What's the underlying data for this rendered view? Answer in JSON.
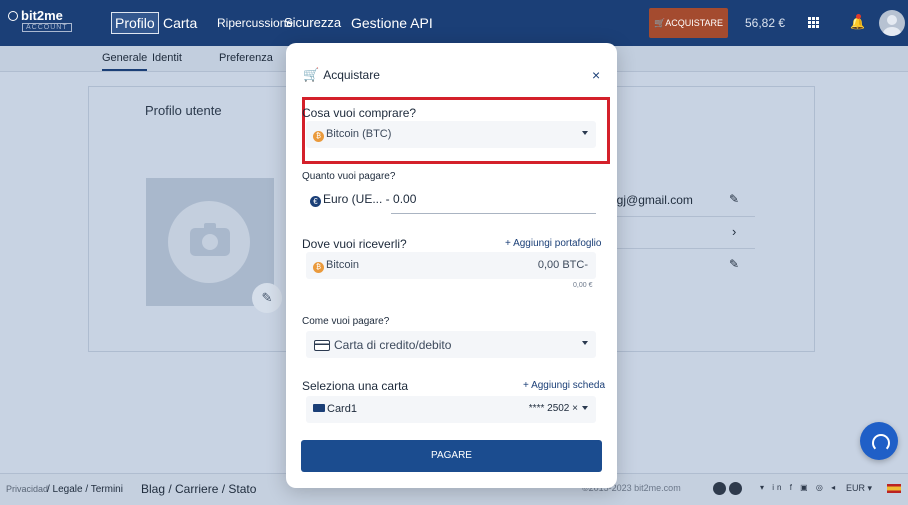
{
  "app": {
    "logo": "bit2me",
    "logo_sub": "ACCOUNT"
  },
  "nav": {
    "items": [
      "Profilo",
      "Carta",
      "Ripercussione",
      "Sicurezza",
      "Gestione API"
    ],
    "buy_label": "ACQUISTARE",
    "balance": "56,82 €"
  },
  "subnav": {
    "items": [
      "Generale",
      "Identit",
      "Preferenza"
    ]
  },
  "profile": {
    "title": "Profilo utente",
    "email_tail": "ngj@gmail.com"
  },
  "footer": {
    "privacy": "Privacidad",
    "legal": "/ Legale / Termini",
    "blog": "Blag / Carriere / Stato",
    "copyright": "©2015-2023 bit2me.com",
    "social": "▾ in f ▣ ◎ ◂",
    "currency": "EUR ▾"
  },
  "modal": {
    "title": "Acquistare",
    "close": "×",
    "buy_question": "Cosa vuoi comprare?",
    "buy_coin": "Bitcoin (BTC)",
    "pay_question": "Quanto vuoi pagare?",
    "pay_currency": "Euro (UE... -",
    "pay_amount": "0.00",
    "receive_question": "Dove vuoi riceverli?",
    "add_wallet": "+ Aggiungi portafoglio",
    "receive_coin": "Bitcoin",
    "receive_amount": "0,00 BTC-",
    "receive_eur": "0,00 €",
    "method_question": "Come vuoi pagare?",
    "method_value": "Carta di credito/debito",
    "card_question": "Seleziona una carta",
    "add_card": "+ Aggiungi scheda",
    "card_name": "Card1",
    "card_number": "**** 2502 ×",
    "pay_button": "PAGARE"
  },
  "colors": {
    "navbar": "#1b3f77",
    "accent_buy": "#a44b2f",
    "highlight": "#d4202a",
    "primary_button": "#1b4c8f"
  }
}
